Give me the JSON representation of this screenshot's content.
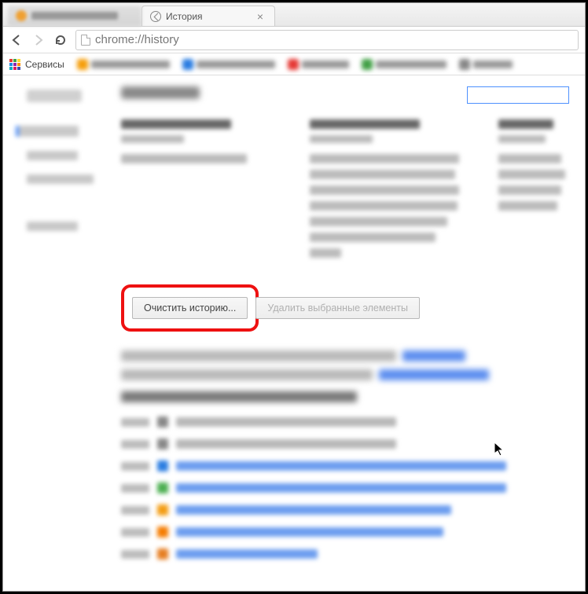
{
  "tabs": {
    "active_title": "История",
    "close_glyph": "×"
  },
  "toolbar": {
    "url": "chrome://history"
  },
  "bookmarks": {
    "apps_label": "Сервисы"
  },
  "actions": {
    "clear_history": "Очистить историю...",
    "delete_selected": "Удалить выбранные элементы"
  }
}
